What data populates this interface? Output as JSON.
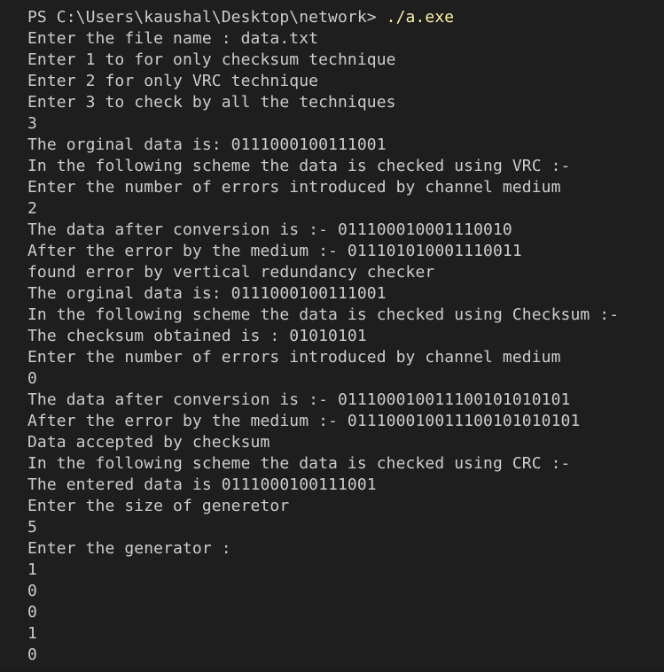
{
  "prompt": {
    "path": "PS C:\\Users\\kaushal\\Desktop\\network> ",
    "command": "./a.exe"
  },
  "output_lines": [
    "Enter the file name : data.txt",
    "Enter 1 to for only checksum technique",
    "Enter 2 for only VRC technique",
    "Enter 3 to check by all the techniques",
    "3",
    "The orginal data is: 0111000100111001",
    "In the following scheme the data is checked using VRC :-",
    "Enter the number of errors introduced by channel medium",
    "2",
    "The data after conversion is :- 011100010001110010",
    "After the error by the medium :- 011101010001110011",
    "found error by vertical redundancy checker",
    "The orginal data is: 0111000100111001",
    "In the following scheme the data is checked using Checksum :-",
    "The checksum obtained is : 01010101",
    "Enter the number of errors introduced by channel medium",
    "0",
    "The data after conversion is :- 011100010011100101010101",
    "After the error by the medium :- 011100010011100101010101",
    "Data accepted by checksum",
    "In the following scheme the data is checked using CRC :-",
    "The entered data is 0111000100111001",
    "Enter the size of generetor",
    "5",
    "Enter the generator :",
    "1",
    "0",
    "0",
    "1",
    "0"
  ],
  "colors": {
    "background": "#1e1e1e",
    "text": "#cccccc",
    "command": "#f9f1a5"
  }
}
